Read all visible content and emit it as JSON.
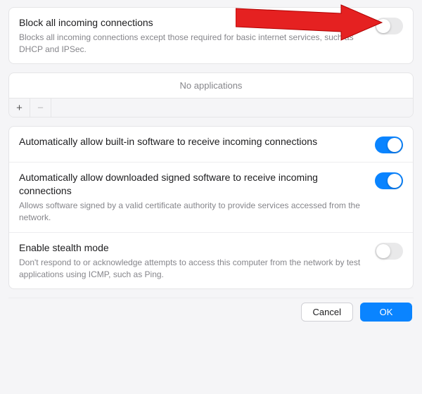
{
  "block_all": {
    "title": "Block all incoming connections",
    "desc": "Blocks all incoming connections except those required for basic internet services, such as DHCP and IPSec.",
    "enabled": false
  },
  "apps": {
    "empty_label": "No applications",
    "add_symbol": "+",
    "remove_symbol": "−"
  },
  "allow_builtin": {
    "title": "Automatically allow built-in software to receive incoming connections",
    "enabled": true
  },
  "allow_signed": {
    "title": "Automatically allow downloaded signed software to receive incoming connections",
    "desc": "Allows software signed by a valid certificate authority to provide services accessed from the network.",
    "enabled": true
  },
  "stealth": {
    "title": "Enable stealth mode",
    "desc": "Don't respond to or acknowledge attempts to access this computer from the network by test applications using ICMP, such as Ping.",
    "enabled": false
  },
  "footer": {
    "cancel": "Cancel",
    "ok": "OK"
  },
  "colors": {
    "accent": "#0a84ff"
  }
}
